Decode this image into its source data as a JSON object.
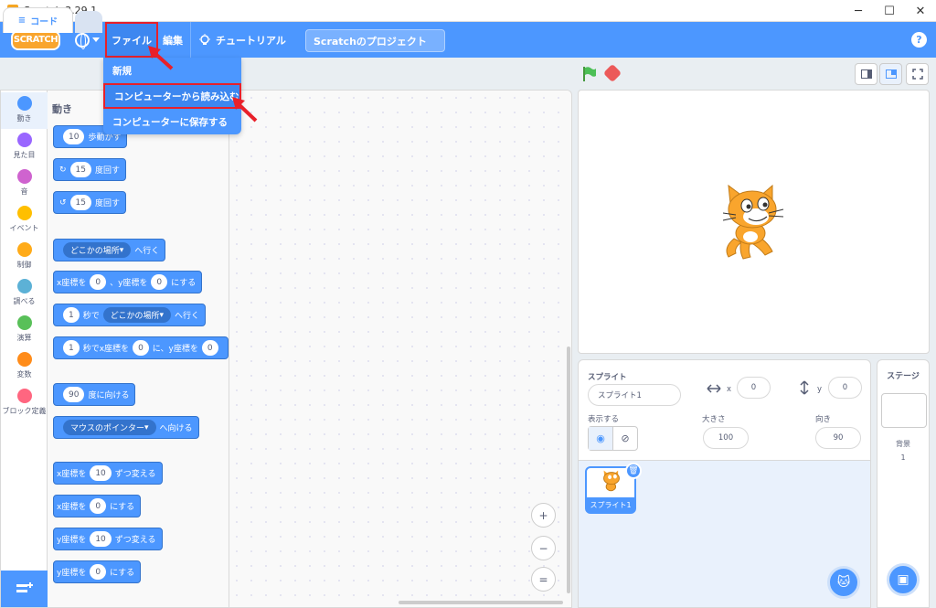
{
  "window": {
    "title": "Scratch 3.29.1",
    "minimize": "─",
    "maximize": "☐",
    "close": "✕"
  },
  "menubar": {
    "logo": "SCRATCH",
    "file": "ファイル",
    "edit": "編集",
    "tutorial": "チュートリアル",
    "project_title": "Scratchのプロジェクト",
    "help": "?"
  },
  "file_menu": {
    "items": [
      "新規",
      "コンピューターから読み込む",
      "コンピューターに保存する"
    ],
    "highlighted_index": 1
  },
  "tabs": {
    "code": "コード"
  },
  "categories": [
    {
      "label": "動き",
      "color": "#4c97ff"
    },
    {
      "label": "見た目",
      "color": "#9966ff"
    },
    {
      "label": "音",
      "color": "#cf63cf"
    },
    {
      "label": "イベント",
      "color": "#ffbf00"
    },
    {
      "label": "制御",
      "color": "#ffab19"
    },
    {
      "label": "調べる",
      "color": "#5cb1d6"
    },
    {
      "label": "演算",
      "color": "#59c059"
    },
    {
      "label": "変数",
      "color": "#ff8c1a"
    },
    {
      "label": "ブロック定義",
      "color": "#ff6680"
    }
  ],
  "palette": {
    "heading": "動き",
    "blocks": {
      "move": {
        "value": "10",
        "text": "歩動かす"
      },
      "turn_right": {
        "value": "15",
        "text": "度回す"
      },
      "turn_left": {
        "value": "15",
        "text": "度回す"
      },
      "goto": {
        "drop": "どこかの場所",
        "text": "へ行く"
      },
      "goto_xy": {
        "pre": "x座標を",
        "x": "0",
        "mid": "、y座標を",
        "y": "0",
        "post": "にする"
      },
      "glide": {
        "secs": "1",
        "mid": "秒で",
        "drop": "どこかの場所",
        "post": "へ行く"
      },
      "glide_xy": {
        "secs": "1",
        "mid": "秒でx座標を",
        "x": "0",
        "mid2": "に、y座標を",
        "y": "0"
      },
      "point_dir": {
        "value": "90",
        "text": "度に向ける"
      },
      "point_towards": {
        "drop": "マウスのポインター",
        "text": "へ向ける"
      },
      "change_x": {
        "pre": "x座標を",
        "value": "10",
        "post": "ずつ変える"
      },
      "set_x": {
        "pre": "x座標を",
        "value": "0",
        "post": "にする"
      },
      "change_y": {
        "pre": "y座標を",
        "value": "10",
        "post": "ずつ変える"
      },
      "set_y": {
        "pre": "y座標を",
        "value": "0",
        "post": "にする"
      }
    }
  },
  "zoom": {
    "in": "+",
    "out": "−",
    "reset": "="
  },
  "sprite_info": {
    "sprite_label": "スプライト",
    "sprite_name": "スプライト1",
    "x_label": "x",
    "x_value": "0",
    "y_label": "y",
    "y_value": "0",
    "show_label": "表示する",
    "size_label": "大きさ",
    "size_value": "100",
    "direction_label": "向き",
    "direction_value": "90"
  },
  "sprite_list": [
    {
      "name": "スプライト1",
      "selected": true
    }
  ],
  "stage_panel": {
    "title": "ステージ",
    "backdrop_label": "背景",
    "backdrop_count": "1"
  }
}
